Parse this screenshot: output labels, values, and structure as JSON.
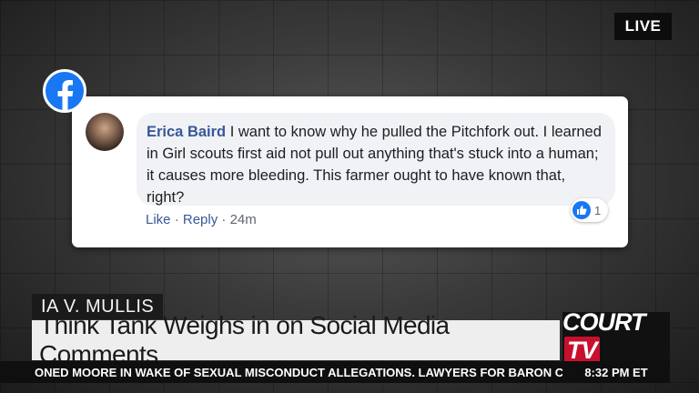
{
  "broadcast": {
    "live_label": "LIVE",
    "case_label": "IA V. MULLIS",
    "headline": "Think Tank Weighs in on Social Media Comments",
    "ticker_text": "ONED MOORE IN WAKE OF SEXUAL MISCONDUCT ALLEGATIONS. LAWYERS FOR BARON COH",
    "time": "8:32 PM ET",
    "logo_main": "COURT",
    "logo_tv": "TV"
  },
  "comment": {
    "author": "Erica Baird",
    "text": "I want to know why he pulled the Pitchfork out. I learned in Girl scouts first aid not pull out anything that's stuck into a human; it causes more bleeding. This farmer ought to have known that, right?",
    "like_label": "Like",
    "separator": "·",
    "reply_label": "Reply",
    "timestamp": "24m",
    "reaction_count": "1",
    "icons": {
      "platform": "facebook-icon",
      "reaction": "thumbs-up-icon"
    }
  },
  "colors": {
    "facebook_blue": "#1877f2",
    "link_blue": "#385898",
    "brand_red": "#c8102e"
  }
}
